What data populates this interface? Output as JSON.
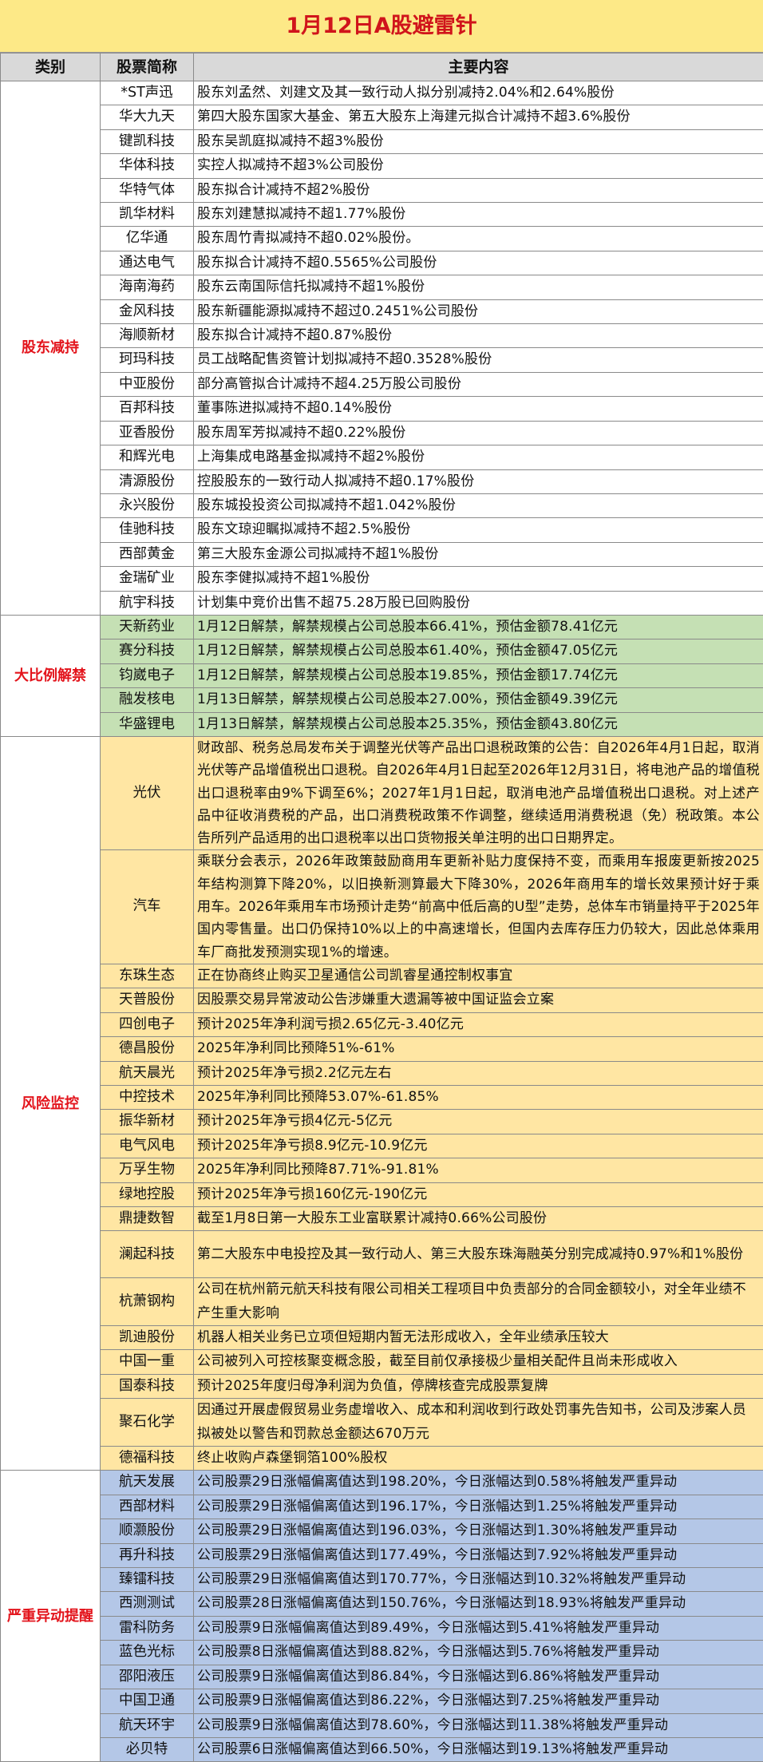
{
  "title": "1月12日A股避雷针",
  "headers": {
    "category": "类别",
    "stock": "股票简称",
    "content": "主要内容"
  },
  "groups": [
    {
      "category": "股东减持",
      "theme": "red",
      "rows": [
        {
          "name": "*ST声迅",
          "content": "股东刘孟然、刘建文及其一致行动人拟分别减持2.04%和2.64%股份"
        },
        {
          "name": "华大九天",
          "content": "第四大股东国家大基金、第五大股东上海建元拟合计减持不超3.6%股份"
        },
        {
          "name": "键凯科技",
          "content": "股东吴凯庭拟减持不超3%股份"
        },
        {
          "name": "华体科技",
          "content": "实控人拟减持不超3%公司股份"
        },
        {
          "name": "华特气体",
          "content": "股东拟合计减持不超2%股份"
        },
        {
          "name": "凯华材料",
          "content": "股东刘建慧拟减持不超1.77%股份"
        },
        {
          "name": "亿华通",
          "content": "股东周竹青拟减持不超0.02%股份。"
        },
        {
          "name": "通达电气",
          "content": "股东拟合计减持不超0.5565%公司股份"
        },
        {
          "name": "海南海药",
          "content": "股东云南国际信托拟减持不超1%股份"
        },
        {
          "name": "金风科技",
          "content": "股东新疆能源拟减持不超过0.2451%公司股份"
        },
        {
          "name": "海顺新材",
          "content": "股东拟合计减持不超0.87%股份"
        },
        {
          "name": "珂玛科技",
          "content": "员工战略配售资管计划拟减持不超0.3528%股份"
        },
        {
          "name": "中亚股份",
          "content": "部分高管拟合计减持不超4.25万股公司股份"
        },
        {
          "name": "百邦科技",
          "content": "董事陈进拟减持不超0.14%股份"
        },
        {
          "name": "亚香股份",
          "content": "股东周军芳拟减持不超0.22%股份"
        },
        {
          "name": "和辉光电",
          "content": "上海集成电路基金拟减持不超2%股份"
        },
        {
          "name": "清源股份",
          "content": "控股股东的一致行动人拟减持不超0.17%股份"
        },
        {
          "name": "永兴股份",
          "content": "股东城投投资公司拟减持不超1.042%股份"
        },
        {
          "name": "佳驰科技",
          "content": "股东文琼迎瞩拟减持不超2.5%股份"
        },
        {
          "name": "西部黄金",
          "content": "第三大股东金源公司拟减持不超1%股份"
        },
        {
          "name": "金瑞矿业",
          "content": "股东李健拟减持不超1%股份"
        },
        {
          "name": "航宇科技",
          "content": "计划集中竞价出售不超75.28万股已回购股份"
        }
      ]
    },
    {
      "category": "大比例解禁",
      "theme": "green",
      "rows": [
        {
          "name": "天新药业",
          "content": "1月12日解禁，解禁规模占公司总股本66.41%，预估金额78.41亿元"
        },
        {
          "name": "赛分科技",
          "content": "1月12日解禁，解禁规模占公司总股本61.40%，预估金额47.05亿元"
        },
        {
          "name": "钧崴电子",
          "content": "1月12日解禁，解禁规模占公司总股本19.85%，预估金额17.74亿元"
        },
        {
          "name": "融发核电",
          "content": "1月13日解禁，解禁规模占公司总股本27.00%，预估金额49.39亿元"
        },
        {
          "name": "华盛锂电",
          "content": "1月13日解禁，解禁规模占公司总股本25.35%，预估金额43.80亿元"
        }
      ]
    },
    {
      "category": "风险监控",
      "theme": "orange",
      "rows": [
        {
          "name": "光伏",
          "lines": 4,
          "content": "财政部、税务总局发布关于调整光伏等产品出口退税政策的公告：自2026年4月1日起，取消光伏等产品增值税出口退税。自2026年4月1日起至2026年12月31日，将电池产品的增值税出口退税率由9%下调至6%；2027年1月1日起，取消电池产品增值税出口退税。对上述产品中征收消费税的产品，出口消费税政策不作调整，继续适用消费税退（免）税政策。本公告所列产品适用的出口退税率以出口货物报关单注明的出口日期界定。"
        },
        {
          "name": "汽车",
          "lines": 4,
          "content": "乘联分会表示，2026年政策鼓励商用车更新补贴力度保持不变，而乘用车报废更新按2025年结构测算下降20%，以旧换新测算最大下降30%，2026年商用车的增长效果预计好于乘用车。2026年乘用车市场预计走势“前高中低后高的U型”走势，总体车市销量持平于2025年国内零售量。出口仍保持10%以上的中高速增长，但国内去库存压力仍较大，因此总体乘用车厂商批发预测实现1%的增速。"
        },
        {
          "name": "东珠生态",
          "content": "正在协商终止购买卫星通信公司凯睿星通控制权事宜"
        },
        {
          "name": "天普股份",
          "content": "因股票交易异常波动公告涉嫌重大遗漏等被中国证监会立案"
        },
        {
          "name": "四创电子",
          "content": "预计2025年净利润亏损2.65亿元-3.40亿元"
        },
        {
          "name": "德昌股份",
          "content": "2025年净利同比预降51%-61%"
        },
        {
          "name": "航天晨光",
          "content": "预计2025年净亏损2.2亿元左右"
        },
        {
          "name": "中控技术",
          "content": "2025年净利同比预降53.07%-61.85%"
        },
        {
          "name": "振华新材",
          "content": "预计2025年净亏损4亿元-5亿元"
        },
        {
          "name": "电气风电",
          "content": "预计2025年净亏损8.9亿元-10.9亿元"
        },
        {
          "name": "万孚生物",
          "content": "2025年净利同比预降87.71%-91.81%"
        },
        {
          "name": "绿地控股",
          "content": "预计2025年净亏损160亿元-190亿元"
        },
        {
          "name": "鼎捷数智",
          "content": "截至1月8日第一大股东工业富联累计减持0.66%公司股份"
        },
        {
          "name": "澜起科技",
          "lines": 2,
          "content": "第二大股东中电投控及其一致行动人、第三大股东珠海融英分别完成减持0.97%和1%股份"
        },
        {
          "name": "杭萧钢构",
          "lines": 2,
          "content": "公司在杭州箭元航天科技有限公司相关工程项目中负责部分的合同金额较小，对全年业绩不产生重大影响"
        },
        {
          "name": "凯迪股份",
          "content": "机器人相关业务已立项但短期内暂无法形成收入，全年业绩承压较大"
        },
        {
          "name": "中国一重",
          "content": "公司被列入可控核聚变概念股，截至目前仅承接极少量相关配件且尚未形成收入"
        },
        {
          "name": "国泰科技",
          "content": "预计2025年度归母净利润为负值，停牌核查完成股票复牌"
        },
        {
          "name": "聚石化学",
          "lines": 2,
          "content": "因通过开展虚假贸易业务虚增收入、成本和利润收到行政处罚事先告知书，公司及涉案人员拟被处以警告和罚款总金额达670万元"
        },
        {
          "name": "德福科技",
          "content": "终止收购卢森堡铜箔100%股权"
        }
      ]
    },
    {
      "category": "严重异动提醒",
      "theme": "blue",
      "rows": [
        {
          "name": "航天发展",
          "content": "公司股票29日涨幅偏离值达到198.20%，今日涨幅达到0.58%将触发严重异动"
        },
        {
          "name": "西部材料",
          "content": "公司股票29日涨幅偏离值达到196.17%，今日涨幅达到1.25%将触发严重异动"
        },
        {
          "name": "顺灏股份",
          "content": "公司股票29日涨幅偏离值达到196.03%，今日涨幅达到1.30%将触发严重异动"
        },
        {
          "name": "再升科技",
          "content": "公司股票29日涨幅偏离值达到177.49%，今日涨幅达到7.92%将触发严重异动"
        },
        {
          "name": "臻镭科技",
          "content": "公司股票29日涨幅偏离值达到170.77%，今日涨幅达到10.32%将触发严重异动"
        },
        {
          "name": "西测测试",
          "content": "公司股票28日涨幅偏离值达到150.76%，今日涨幅达到18.93%将触发严重异动"
        },
        {
          "name": "雷科防务",
          "content": "公司股票9日涨幅偏离值达到89.49%，今日涨幅达到5.41%将触发严重异动"
        },
        {
          "name": "蓝色光标",
          "content": "公司股票8日涨幅偏离值达到88.82%，今日涨幅达到5.76%将触发严重异动"
        },
        {
          "name": "邵阳液压",
          "content": "公司股票9日涨幅偏离值达到86.84%，今日涨幅达到6.86%将触发严重异动"
        },
        {
          "name": "中国卫通",
          "content": "公司股票9日涨幅偏离值达到86.22%，今日涨幅达到7.25%将触发严重异动"
        },
        {
          "name": "航天环宇",
          "content": "公司股票9日涨幅偏离值达到78.60%，今日涨幅达到11.38%将触发严重异动"
        },
        {
          "name": "必贝特",
          "content": "公司股票6日涨幅偏离值达到66.50%，今日涨幅达到19.13%将触发严重异动"
        }
      ]
    }
  ]
}
